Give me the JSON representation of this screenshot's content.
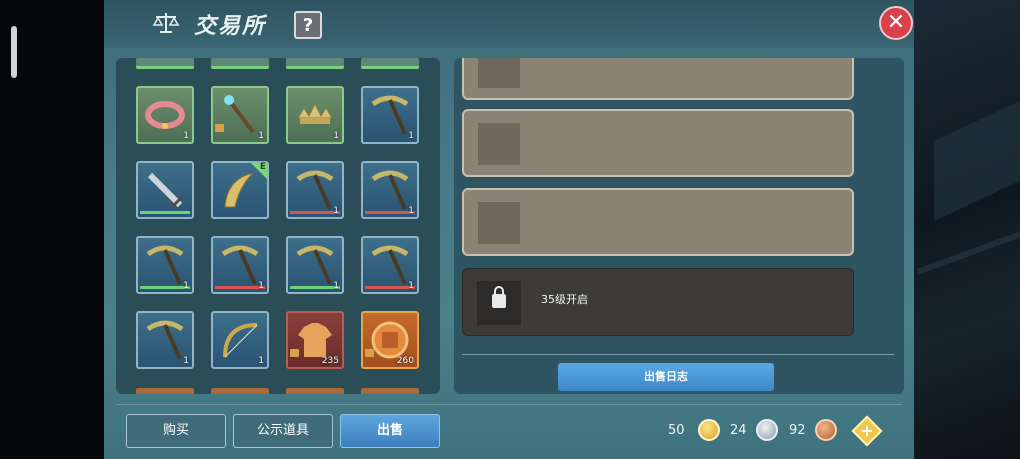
{
  "window": {
    "title": "交易所",
    "help_label": "?",
    "close_label": "✕"
  },
  "inventory": {
    "items": [
      {
        "icon": "collar-icon",
        "qty": "1",
        "style": "green"
      },
      {
        "icon": "staff-icon",
        "qty": "1",
        "style": "green"
      },
      {
        "icon": "thorn-crown-icon",
        "qty": "1",
        "style": "green"
      },
      {
        "icon": "pickaxe-icon",
        "qty": "1",
        "style": "blue"
      },
      {
        "icon": "sword-icon",
        "qty": "",
        "style": "blue"
      },
      {
        "icon": "curved-blade-icon",
        "qty": "",
        "style": "blue",
        "tag": "E"
      },
      {
        "icon": "pickaxe-icon",
        "qty": "1",
        "style": "blue"
      },
      {
        "icon": "pickaxe-icon",
        "qty": "1",
        "style": "blue"
      },
      {
        "icon": "pickaxe-icon",
        "qty": "1",
        "style": "blue"
      },
      {
        "icon": "pickaxe-icon",
        "qty": "1",
        "style": "blue"
      },
      {
        "icon": "pickaxe-icon",
        "qty": "1",
        "style": "blue"
      },
      {
        "icon": "pickaxe-icon",
        "qty": "1",
        "style": "blue"
      },
      {
        "icon": "pickaxe-icon",
        "qty": "1",
        "style": "blue"
      },
      {
        "icon": "bow-icon",
        "qty": "1",
        "style": "blue"
      },
      {
        "icon": "shirt-icon",
        "qty": "235",
        "style": "red"
      },
      {
        "icon": "medal-icon",
        "qty": "260",
        "style": "orange"
      }
    ]
  },
  "sell_log": {
    "locked_label": "35级开启",
    "button_label": "出售日志"
  },
  "tabs": {
    "buy": "购买",
    "public": "公示道具",
    "sell": "出售"
  },
  "currency": {
    "gold": "50",
    "silver": "24",
    "bronze": "92"
  },
  "colors": {
    "accent_blue": "#4a94d6",
    "panel_teal": "#2b4d58",
    "close_red": "#d8404a"
  }
}
